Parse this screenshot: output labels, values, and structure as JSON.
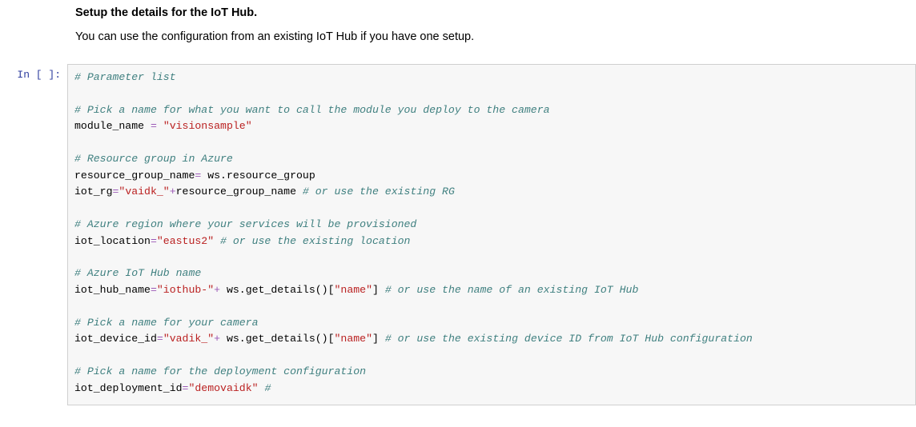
{
  "text": {
    "heading": "Setup the details for the IoT Hub.",
    "description": "You can use the configuration from an existing IoT Hub if you have one setup."
  },
  "notebook": {
    "prompt": "In [ ]:",
    "code": {
      "c_param_list": "# Parameter list",
      "c_module": "# Pick a name for what you want to call the module you deploy to the camera",
      "l_module_lhs": "module_name ",
      "eq": "=",
      "sp": " ",
      "s_visionsample": "\"visionsample\"",
      "c_rg_hdr": "# Resource group in Azure",
      "l_rg1": "resource_group_name",
      "l_rg1_rhs": " ws.resource_group",
      "l_rg2_lhs": "iot_rg",
      "s_vaidk": "\"vaidk_\"",
      "plus": "+",
      "l_rg2_rhs": "resource_group_name ",
      "c_rg_or": "# or use the existing RG",
      "c_region": "# Azure region where your services will be provisioned",
      "l_loc_lhs": "iot_location",
      "s_eastus2": "\"eastus2\"",
      "c_loc_or": " # or use the existing location",
      "c_hubname": "# Azure IoT Hub name",
      "l_hub_lhs": "iot_hub_name",
      "s_iothub": "\"iothub-\"",
      "l_getdetails_a": " ws.get_details()[",
      "s_name": "\"name\"",
      "l_getdetails_b": "] ",
      "c_hub_or": "# or use the name of an existing IoT Hub",
      "c_camera": "# Pick a name for your camera",
      "l_dev_lhs": "iot_device_id",
      "s_vaidk2": "\"vadik_\"",
      "c_dev_or": "# or use the existing device ID from IoT Hub configuration",
      "c_deploy": "# Pick a name for the deployment configuration",
      "l_dep_lhs": "iot_deployment_id",
      "s_demovaidk": "\"demovaidk\"",
      "c_hash": " #"
    }
  }
}
